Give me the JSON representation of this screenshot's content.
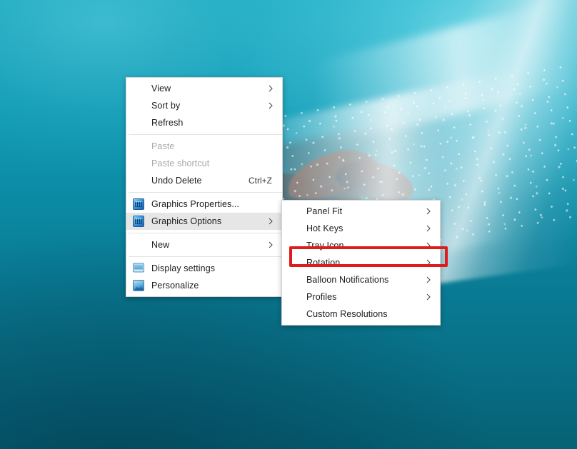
{
  "desktop": {
    "wallpaper_description": "underwater ocean scene with whale flukes and white foam",
    "colors": {
      "water_light": "#17a7bd",
      "water_deep": "#066174",
      "foam": "#ffffff",
      "highlight_red": "#e01b1b",
      "menu_bg": "#ffffff",
      "menu_border": "#d6d6d6",
      "menu_hover": "#e6e6e6",
      "disabled_text": "#a8a8a8"
    }
  },
  "context_menu": {
    "name": "desktop-context-menu",
    "groups": [
      {
        "items": [
          {
            "label": "View",
            "submenu": true,
            "disabled": false,
            "icon": null,
            "accel": ""
          },
          {
            "label": "Sort by",
            "submenu": true,
            "disabled": false,
            "icon": null,
            "accel": ""
          },
          {
            "label": "Refresh",
            "submenu": false,
            "disabled": false,
            "icon": null,
            "accel": ""
          }
        ]
      },
      {
        "items": [
          {
            "label": "Paste",
            "submenu": false,
            "disabled": true,
            "icon": null,
            "accel": ""
          },
          {
            "label": "Paste shortcut",
            "submenu": false,
            "disabled": true,
            "icon": null,
            "accel": ""
          },
          {
            "label": "Undo Delete",
            "submenu": false,
            "disabled": false,
            "icon": null,
            "accel": "Ctrl+Z"
          }
        ]
      },
      {
        "items": [
          {
            "label": "Graphics Properties...",
            "submenu": false,
            "disabled": false,
            "icon": "graphics-icon",
            "accel": ""
          },
          {
            "label": "Graphics Options",
            "submenu": true,
            "disabled": false,
            "icon": "graphics-icon",
            "accel": "",
            "highlighted": true
          }
        ]
      },
      {
        "items": [
          {
            "label": "New",
            "submenu": true,
            "disabled": false,
            "icon": null,
            "accel": ""
          }
        ]
      },
      {
        "items": [
          {
            "label": "Display settings",
            "submenu": false,
            "disabled": false,
            "icon": "monitor-icon",
            "accel": ""
          },
          {
            "label": "Personalize",
            "submenu": false,
            "disabled": false,
            "icon": "personalize-icon",
            "accel": ""
          }
        ]
      }
    ]
  },
  "submenu": {
    "name": "graphics-options-submenu",
    "items": [
      {
        "label": "Panel Fit",
        "submenu": true,
        "highlighted": false
      },
      {
        "label": "Hot Keys",
        "submenu": true,
        "highlighted": false
      },
      {
        "label": "Tray Icon",
        "submenu": true,
        "highlighted": false
      },
      {
        "label": "Rotation",
        "submenu": true,
        "highlighted": true
      },
      {
        "label": "Balloon Notifications",
        "submenu": true,
        "highlighted": false
      },
      {
        "label": "Profiles",
        "submenu": true,
        "highlighted": false
      },
      {
        "label": "Custom Resolutions",
        "submenu": false,
        "highlighted": false
      }
    ]
  },
  "annotation": {
    "name": "rotation-highlight-box",
    "target_label": "Rotation",
    "color": "#e01b1b"
  }
}
